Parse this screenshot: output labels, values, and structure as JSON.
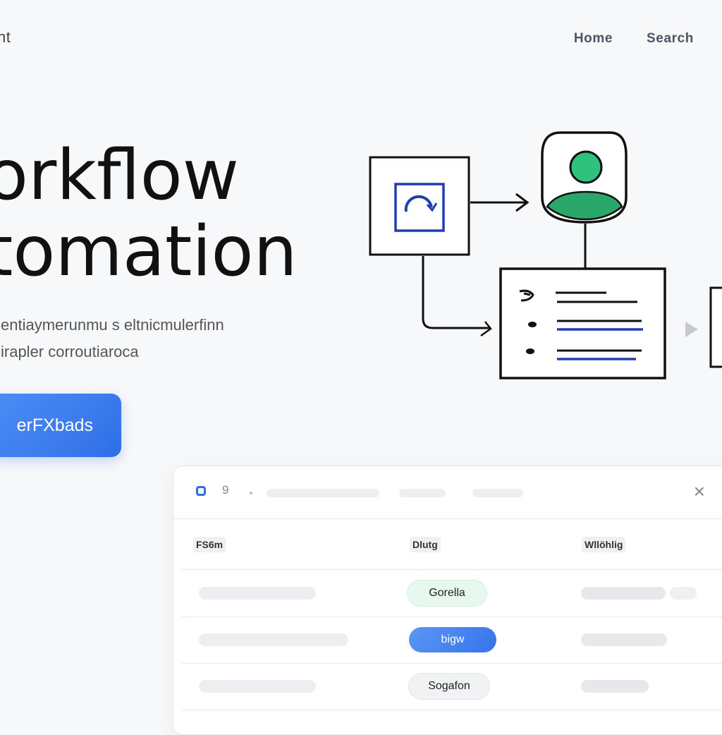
{
  "header": {
    "brand": "nt",
    "nav": [
      "Home",
      "Search"
    ]
  },
  "hero": {
    "title_line1": "orkflow",
    "title_line2": "tomation",
    "subtitle_line1": "sentiaymerunmu s eltnicmulerfinn",
    "subtitle_line2": "sirapler corroutiaroca",
    "cta_label": "erFXbads"
  },
  "diagram": {
    "icon_names": [
      "refresh-icon",
      "user-avatar-icon",
      "list-doc-icon",
      "next-arrow-icon"
    ],
    "colors": {
      "avatar": "#22b573",
      "accent": "#1f3fb0"
    }
  },
  "panel": {
    "search_glyph": "9",
    "close_glyph": "×",
    "columns": [
      "FS6m",
      "Dlutg",
      "Wllöhlig"
    ],
    "rows": [
      {
        "status": "Gorella",
        "tone": "green"
      },
      {
        "status": "bigw",
        "tone": "blue"
      },
      {
        "status": "Sogafon",
        "tone": "gray"
      }
    ]
  },
  "colors": {
    "primary": "#2f6fe6",
    "success": "#22b573",
    "background": "#f7f8fa"
  }
}
